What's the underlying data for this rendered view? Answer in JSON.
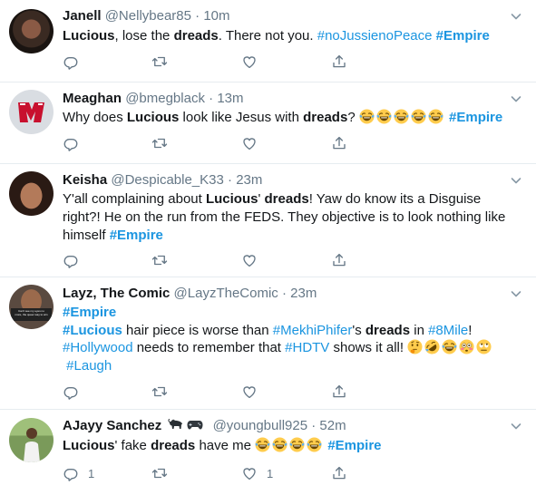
{
  "colors": {
    "name": "#14171a",
    "meta": "#657786",
    "hashtag": "#1b95e0",
    "divider": "#e6ecf0"
  },
  "tweets": [
    {
      "name": "Janell",
      "handle": "@Nellybear85",
      "time": "10m",
      "avatar_icon": "dark-portrait-avatar",
      "t": {
        "a": "Lucious",
        "b": ", lose the ",
        "c": "dreads",
        "d": ". There not you. ",
        "e": "#noJussienoPeace",
        "f": "#Empire"
      },
      "reply_count": "",
      "like_count": ""
    },
    {
      "name": "Meaghan",
      "handle": "@bmegblack",
      "time": "13m",
      "avatar_icon": "sports-logo-avatar",
      "t": {
        "a": "Why does ",
        "b": "Lucious",
        "c": " look like Jesus with ",
        "d": "dreads",
        "e": "? ",
        "f": "#Empire"
      },
      "emojis": [
        "face-with-tears-of-joy-icon",
        "face-with-tears-of-joy-icon",
        "face-with-tears-of-joy-icon",
        "face-with-tears-of-joy-icon",
        "face-with-tears-of-joy-icon"
      ],
      "reply_count": "",
      "like_count": ""
    },
    {
      "name": "Keisha",
      "handle": "@Despicable_K33",
      "time": "23m",
      "avatar_icon": "woman-portrait-avatar",
      "t": {
        "a": "Y'all complaining about ",
        "b": "Lucious",
        "c": "' ",
        "d": "dreads",
        "e": "! Yaw do know its a Disguise right?! He on the run from the FEDS. They objective is to look nothing like himself ",
        "f": "#Empire"
      },
      "reply_count": "",
      "like_count": ""
    },
    {
      "name": "Layz, The Comic",
      "handle": "@LayzTheComic",
      "time": "23m",
      "avatar_icon": "meme-portrait-avatar",
      "avatar_text": "Can't see my eyes no more, the queer way to win",
      "t": {
        "a": "#Empire",
        "b": "#Lucious",
        "c": " hair piece is worse than ",
        "d": "#MekhiPhifer",
        "e": "'s ",
        "f": "dreads",
        "g": " in ",
        "h": "#8Mile",
        "i": "! ",
        "j": "#Hollywood",
        "k": " needs to remember that ",
        "l": "#HDTV",
        "m": " shows it all! ",
        "n": "#Laugh"
      },
      "emojis": [
        "thinking-face-icon",
        "rolling-on-floor-laughing-icon",
        "face-with-tears-of-joy-icon",
        "flushed-face-icon",
        "face-with-rolling-eyes-icon"
      ],
      "reply_count": "",
      "like_count": ""
    },
    {
      "name": "AJayy Sanchez",
      "handle": "@youngbull925",
      "time": "52m",
      "avatar_icon": "man-outdoor-avatar",
      "name_emojis": [
        "water-buffalo-icon",
        "video-game-controller-icon"
      ],
      "t": {
        "a": "Lucious",
        "b": "' fake ",
        "c": "dreads",
        "d": " have me ",
        "e": "#Empire"
      },
      "emojis": [
        "face-with-tears-of-joy-icon",
        "face-with-tears-of-joy-icon",
        "face-with-tears-of-joy-icon",
        "face-with-tears-of-joy-icon"
      ],
      "reply_count": "1",
      "like_count": "1"
    }
  ],
  "separator": "·"
}
